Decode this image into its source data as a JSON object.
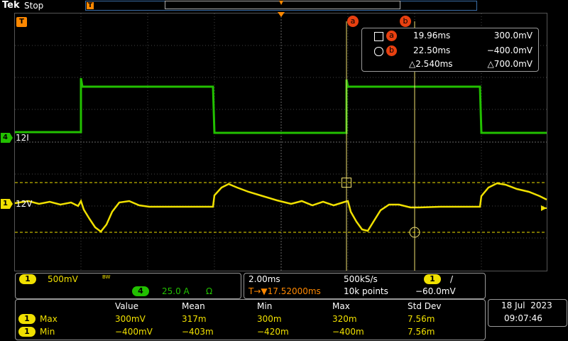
{
  "header": {
    "brand": "Tek",
    "state": "Stop",
    "trigger_marker_label": "T"
  },
  "screen": {
    "ch4_label": "4",
    "ch4_scale_text": "12I",
    "ch1_label": "1",
    "ch1_scale_text": "12V",
    "trigger_label": "T",
    "cursor_a_label": "a",
    "cursor_b_label": "b"
  },
  "cursor_readout": {
    "a_label": "a",
    "a_time": "19.96ms",
    "a_value": "300.0mV",
    "b_label": "b",
    "b_time": "22.50ms",
    "b_value": "−400.0mV",
    "delta_time": "△2.540ms",
    "delta_value": "△700.0mV"
  },
  "channel_panel": {
    "ch1_label": "1",
    "ch1_scale": "500mV",
    "bw_text": "BW",
    "ch4_label": "4",
    "ch4_scale": "25.0 A",
    "ohm_text": "Ω"
  },
  "timebase_panel": {
    "time_per_div": "2.00ms",
    "sample_rate": "500kS/s",
    "trig_ch_label": "1",
    "trig_slope": "/",
    "trigger_position": "T→▼17.52000ms",
    "record_length": "10k points",
    "trigger_level": "−60.0mV"
  },
  "measurements": {
    "headers": [
      "Value",
      "Mean",
      "Min",
      "Max",
      "Std Dev"
    ],
    "rows": [
      {
        "ch": "1",
        "name": "Max",
        "cells": [
          "300mV",
          "317m",
          "300m",
          "320m",
          "7.56m"
        ]
      },
      {
        "ch": "1",
        "name": "Min",
        "cells": [
          "−400mV",
          "−403m",
          "−420m",
          "−400m",
          "7.56m"
        ]
      }
    ]
  },
  "datetime": {
    "date": "18 Jul  2023",
    "time": "09:07:46"
  },
  "colors": {
    "ch1": "#f0e000",
    "ch4": "#22c000",
    "accent": "#ff8800"
  }
}
